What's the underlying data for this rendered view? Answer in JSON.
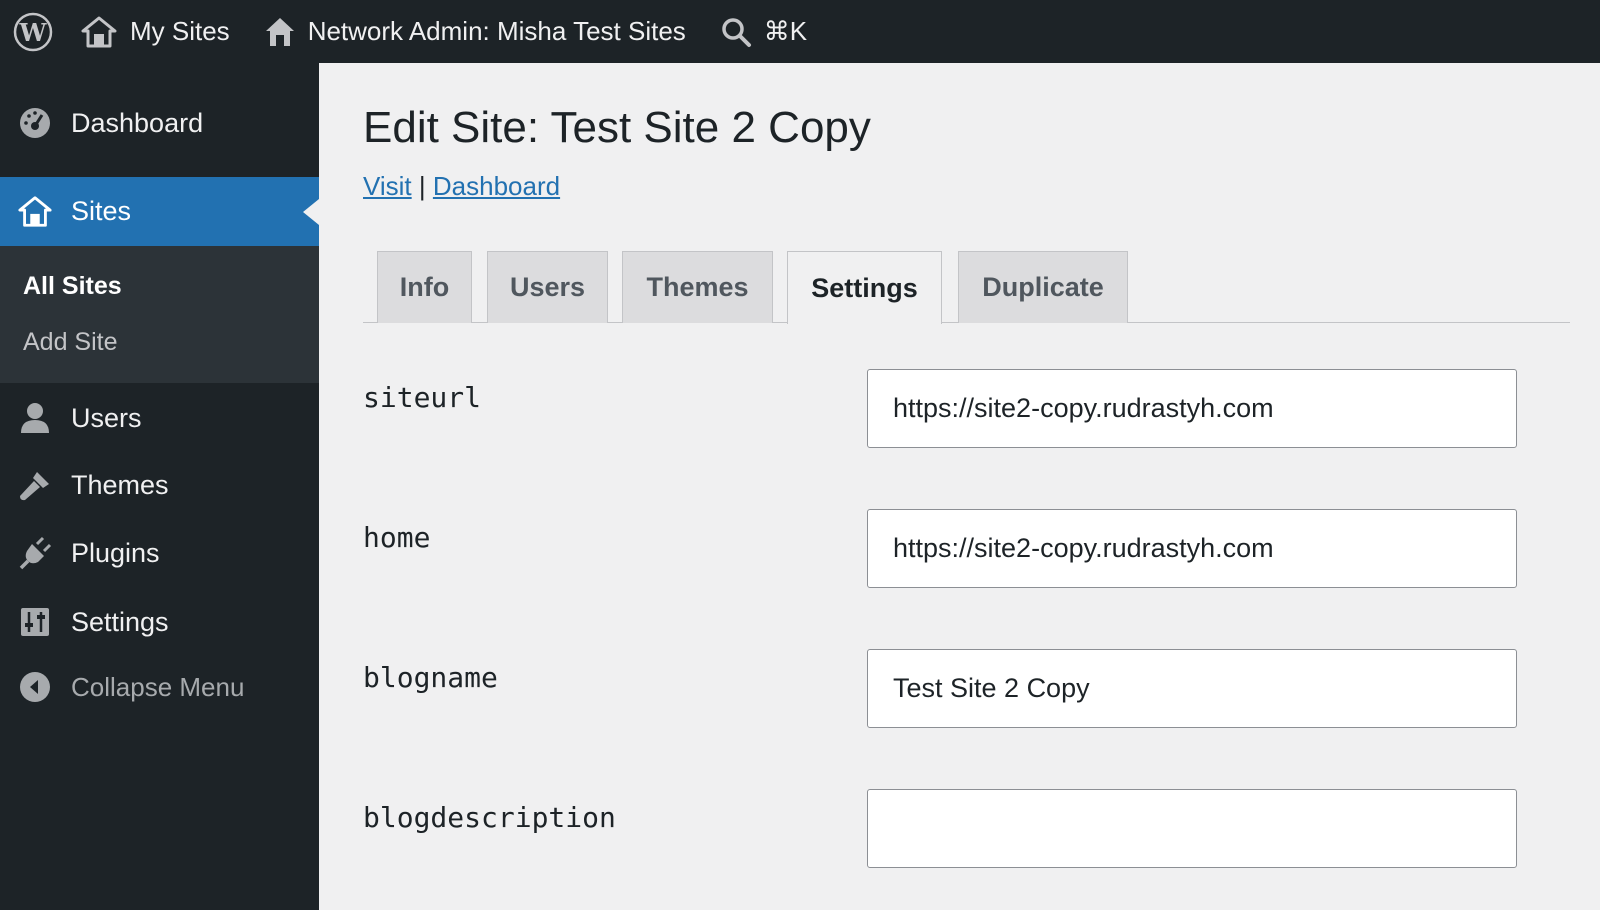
{
  "adminbar": {
    "my_sites": "My Sites",
    "network_admin": "Network Admin: Misha Test Sites",
    "search_shortcut": "⌘K"
  },
  "sidebar": {
    "items": [
      {
        "label": "Dashboard",
        "icon": "dashboard-icon"
      },
      {
        "label": "Sites",
        "icon": "sites-icon",
        "active": true
      },
      {
        "label": "Users",
        "icon": "user-icon"
      },
      {
        "label": "Themes",
        "icon": "brush-icon"
      },
      {
        "label": "Plugins",
        "icon": "plugin-icon"
      },
      {
        "label": "Settings",
        "icon": "settings-icon"
      },
      {
        "label": "Collapse Menu",
        "icon": "collapse-icon"
      }
    ],
    "submenu": [
      {
        "label": "All Sites",
        "current": true
      },
      {
        "label": "Add Site"
      }
    ]
  },
  "page": {
    "title": "Edit Site: Test Site 2 Copy",
    "visit_link": "Visit",
    "separator": "|",
    "dashboard_link": "Dashboard"
  },
  "tabs": [
    {
      "label": "Info"
    },
    {
      "label": "Users"
    },
    {
      "label": "Themes"
    },
    {
      "label": "Settings",
      "active": true
    },
    {
      "label": "Duplicate"
    }
  ],
  "fields": [
    {
      "label": "siteurl",
      "value": "https://site2-copy.rudrastyh.com"
    },
    {
      "label": "home",
      "value": "https://site2-copy.rudrastyh.com"
    },
    {
      "label": "blogname",
      "value": "Test Site 2 Copy"
    },
    {
      "label": "blogdescription",
      "value": ""
    }
  ],
  "colors": {
    "adminbar_bg": "#1d2327",
    "accent": "#2271b1",
    "submenu_bg": "#2c3338",
    "content_bg": "#f0f0f1"
  }
}
